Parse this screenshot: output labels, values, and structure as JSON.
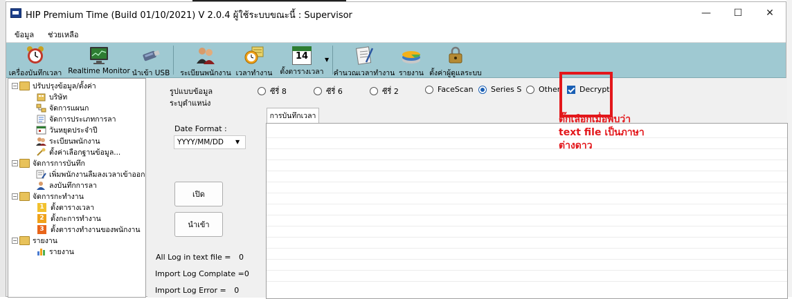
{
  "window": {
    "title": "HIP Premium Time (Build 01/10/2021) V 2.0.4   ผู้ใช้ระบบขณะนี้ : Supervisor",
    "controls": {
      "minimize": "—",
      "maximize": "☐",
      "close": "✕"
    }
  },
  "menu": {
    "items": [
      "ข้อมูล",
      "ช่วยเหลือ"
    ]
  },
  "toolbar": {
    "items": [
      {
        "label": "เครื่องบันทึกเวลา",
        "icon": "alarm-clock-icon"
      },
      {
        "label": "Realtime Monitor",
        "icon": "monitor-icon"
      },
      {
        "label": "นำเข้า USB",
        "icon": "usb-drive-icon"
      },
      {
        "label": "ระเบียนพนักงาน",
        "icon": "people-icon"
      },
      {
        "label": "เวลาทำงาน",
        "icon": "work-time-icon"
      },
      {
        "label": "ตั้งตารางเวลา",
        "icon": "calendar-icon",
        "calendar_day": "14"
      },
      {
        "label": "คำนวณเวลาทำงาน",
        "icon": "calculate-icon"
      },
      {
        "label": "รายงาน",
        "icon": "report-chart-icon"
      },
      {
        "label": "ตั้งค่าผู้ดูแลระบบ",
        "icon": "admin-lock-icon"
      }
    ]
  },
  "tree": {
    "groups": [
      {
        "label": "ปรับปรุงข้อมูล/ตั้งค่า",
        "items": [
          "บริษัท",
          "จัดการแผนก",
          "จัดการประเภทการลา",
          "วันหยุดประจำปี",
          "ระเบียนพนักงาน",
          "ตั้งค่าเลือกฐานข้อมูล..."
        ]
      },
      {
        "label": "จัดการการบันทึก",
        "items": [
          "เพิ่มพนักงานลืมลงเวลาเข้าออก",
          "ลงบันทึกการลา"
        ]
      },
      {
        "label": "จัดการกะทำงาน",
        "items": [
          {
            "num": "1",
            "label": "ตั้งตารางเวลา"
          },
          {
            "num": "2",
            "label": "ตั้งกะการทำงาน"
          },
          {
            "num": "3",
            "label": "ตั้งตารางทำงานของพนักงาน"
          }
        ]
      },
      {
        "label": "รายงาน",
        "items": [
          "รายงาน"
        ]
      }
    ]
  },
  "form": {
    "format_label": "รูปแบบข้อมูล",
    "position_label": "ระบุตำแหน่ง",
    "options": [
      "ซีรี่ 8",
      "ซีรี่ 6",
      "ซีรี่ 2",
      "FaceScan",
      "Series S",
      "Other"
    ],
    "selected_option": "Series S",
    "decrypt_label": "Decrypt",
    "decrypt_checked": true,
    "date_format_label": "Date Format :",
    "date_format_value": "YYYY/MM/DD",
    "open_button": "เปิด",
    "import_button": "นำเข้า",
    "tab_label": "การบันทึกเวลา",
    "stats": [
      {
        "label": "All Log in text file =",
        "value": "0"
      },
      {
        "label": "Import Log Complate =",
        "value": "0"
      },
      {
        "label": "Import Log Error =",
        "value": "0"
      }
    ]
  },
  "annotation": {
    "lines": [
      "ติ๊กเลือกเมื่อพบว่า",
      "text file เป็นภาษา",
      "ต่างดาว"
    ],
    "color": "#e3171b"
  },
  "colors": {
    "toolbar": "#9fc9d2",
    "accent": "#1a5fb4",
    "highlight": "#e3171b"
  }
}
